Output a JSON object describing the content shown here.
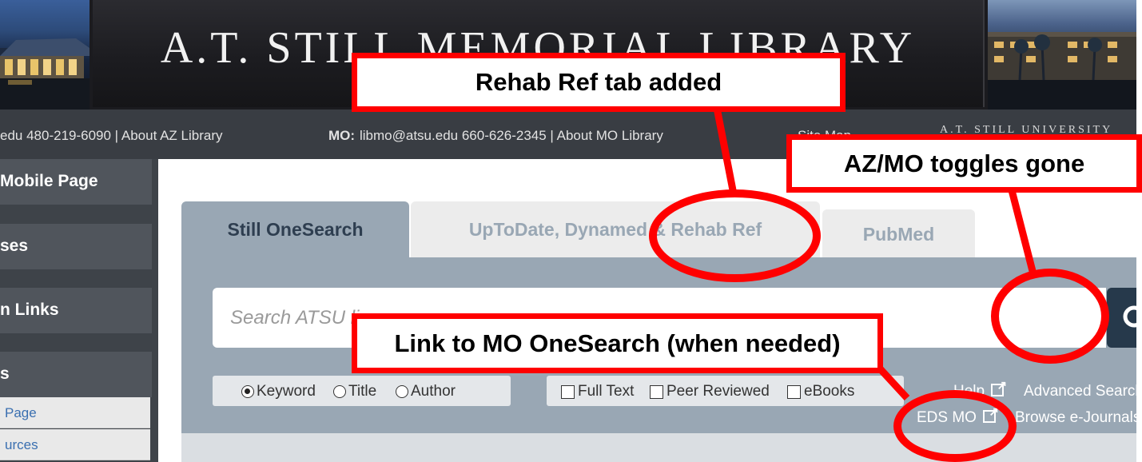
{
  "banner": {
    "title": "A.T. STILL MEMORIAL LIBRARY"
  },
  "contact_bar": {
    "az_fragment": "edu 480-219-6090 | About AZ Library",
    "mo_label": "MO:",
    "mo_contact": "libmo@atsu.edu 660-626-2345 | About MO Library",
    "site_map": "Site Map",
    "university": "A.T. STILL UNIVERSITY"
  },
  "sidebar": {
    "items": [
      {
        "label": "Mobile Page"
      },
      {
        "label": "ses"
      },
      {
        "label": "n Links"
      },
      {
        "label": "s"
      }
    ],
    "subitems": [
      {
        "label": "Page"
      },
      {
        "label": "urces"
      }
    ]
  },
  "tabs": [
    {
      "label": "Still OneSearch",
      "active": true
    },
    {
      "label": "UpToDate, Dynamed & Rehab Ref",
      "active": false
    },
    {
      "label": "PubMed",
      "active": false
    }
  ],
  "search": {
    "placeholder": "Search ATSU li"
  },
  "search_type": {
    "options": [
      {
        "label": "Keyword",
        "selected": true
      },
      {
        "label": "Title",
        "selected": false
      },
      {
        "label": "Author",
        "selected": false
      }
    ]
  },
  "filters": {
    "options": [
      {
        "label": "Full Text",
        "checked": false
      },
      {
        "label": "Peer Reviewed",
        "checked": false
      },
      {
        "label": "eBooks",
        "checked": false
      }
    ]
  },
  "links": {
    "help": "Help",
    "advanced_search": "Advanced Search",
    "eds_mo": "EDS MO",
    "browse_ejournals": "Browse e-Journals"
  },
  "annotations": {
    "rehab_ref": "Rehab Ref tab added",
    "toggles_gone": "AZ/MO toggles gone",
    "mo_onesearch": "Link to MO OneSearch (when needed)"
  },
  "colors": {
    "annotation_red": "#ff0000",
    "panel_blue_gray": "#99a7b4",
    "search_button": "#26394b",
    "link_blue": "#3a6fb0"
  }
}
